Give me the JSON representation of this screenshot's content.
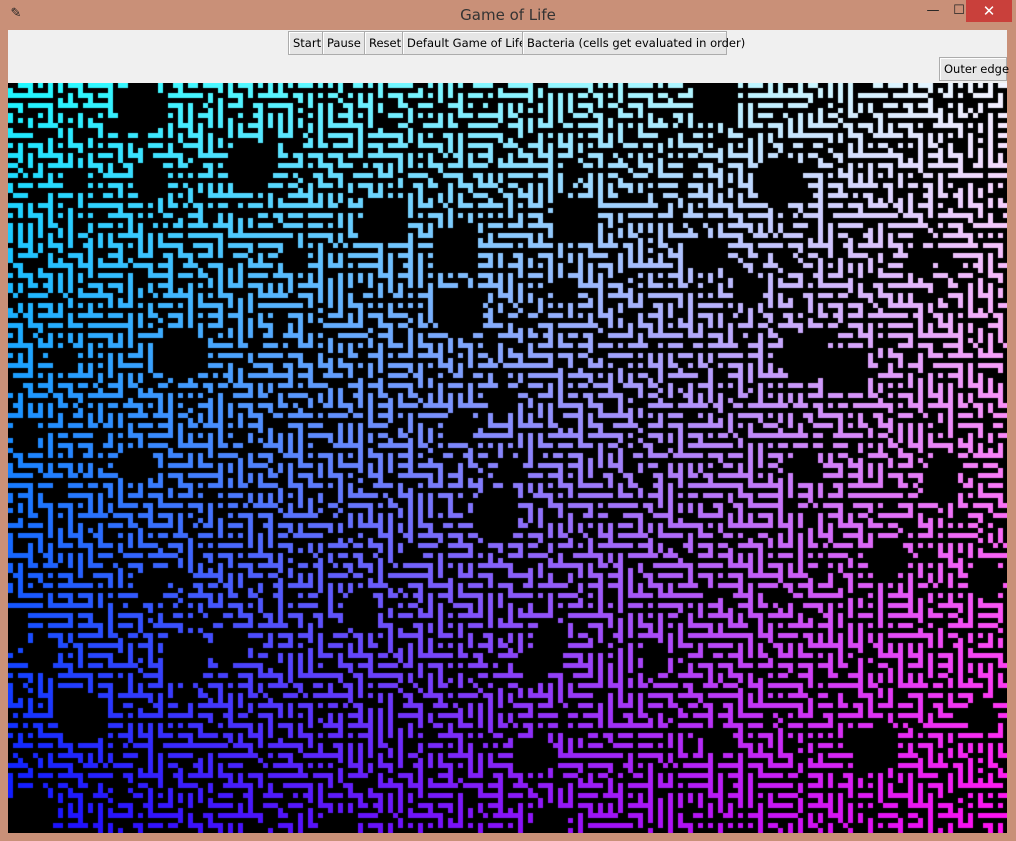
{
  "window": {
    "title": "Game of Life",
    "icon": "feather-icon",
    "controls": {
      "minimize": "—",
      "maximize": "☐",
      "close": "✕"
    }
  },
  "toolbar": {
    "start_label": "Start",
    "pause_label": "Pause",
    "reset_label": "Reset",
    "default_label": "Default Game of Life",
    "bacteria_label": "Bacteria (cells get evaluated in order)",
    "outer_edge_label": "Outer edge"
  },
  "canvas": {
    "background": "#000000",
    "gradient_colors": {
      "top_left": "#20f8ff",
      "top_right": "#f4f4ff",
      "bottom_left": "#1010ff",
      "bottom_right": "#ff10f0"
    }
  }
}
